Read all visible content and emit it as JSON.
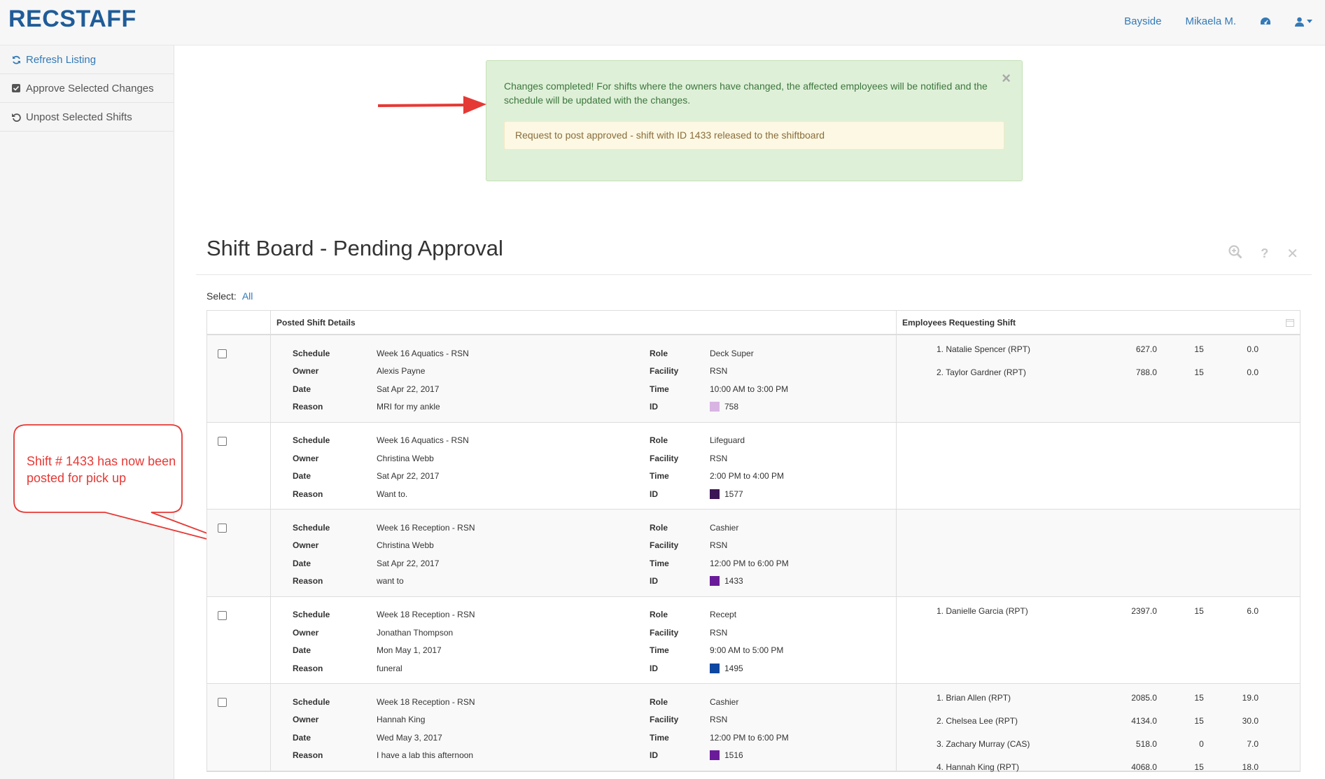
{
  "header": {
    "brand": "RECSTAFF",
    "location": "Bayside",
    "user": "Mikaela M."
  },
  "sidebar": {
    "items": [
      {
        "label": "Refresh Listing",
        "icon": "refresh-icon"
      },
      {
        "label": "Approve Selected Changes",
        "icon": "checkbox-icon"
      },
      {
        "label": "Unpost Selected Shifts",
        "icon": "undo-icon"
      }
    ]
  },
  "alert": {
    "message": "Changes completed! For shifts where the owners have changed, the affected employees will be notified and the schedule will be updated with the changes.",
    "notice": "Request to post approved - shift with ID 1433 released to the shiftboard",
    "close": "×"
  },
  "annotation": {
    "callout": "Shift # 1433 has now been posted for pick up"
  },
  "page": {
    "title": "Shift Board - Pending Approval",
    "select_label": "Select:",
    "select_all": "All"
  },
  "table": {
    "col_details": "Posted Shift Details",
    "col_employees": "Employees Requesting Shift",
    "labels": {
      "schedule": "Schedule",
      "owner": "Owner",
      "date": "Date",
      "reason": "Reason",
      "role": "Role",
      "facility": "Facility",
      "time": "Time",
      "id": "ID"
    },
    "rows": [
      {
        "schedule": "Week 16 Aquatics - RSN",
        "owner": "Alexis Payne",
        "date": "Sat Apr 22, 2017",
        "reason": "MRI for my ankle",
        "role": "Deck Super",
        "facility": "RSN",
        "time": "10:00 AM to 3:00 PM",
        "id": "758",
        "color": "#d8b4e2",
        "employees": [
          {
            "name": "1.  Natalie Spencer (RPT)",
            "a": "627.0",
            "b": "15",
            "c": "0.0"
          },
          {
            "name": "2.  Taylor Gardner (RPT)",
            "a": "788.0",
            "b": "15",
            "c": "0.0"
          }
        ]
      },
      {
        "schedule": "Week 16 Aquatics - RSN",
        "owner": "Christina Webb",
        "date": "Sat Apr 22, 2017",
        "reason": "Want to.",
        "role": "Lifeguard",
        "facility": "RSN",
        "time": "2:00 PM to 4:00 PM",
        "id": "1577",
        "color": "#3b1556",
        "employees": []
      },
      {
        "schedule": "Week 16 Reception - RSN",
        "owner": "Christina Webb",
        "date": "Sat Apr 22, 2017",
        "reason": "want to",
        "role": "Cashier",
        "facility": "RSN",
        "time": "12:00 PM to 6:00 PM",
        "id": "1433",
        "color": "#6a1b9a",
        "employees": []
      },
      {
        "schedule": "Week 18 Reception - RSN",
        "owner": "Jonathan Thompson",
        "date": "Mon May 1, 2017",
        "reason": "funeral",
        "role": "Recept",
        "facility": "RSN",
        "time": "9:00 AM to 5:00 PM",
        "id": "1495",
        "color": "#0d47a1",
        "employees": [
          {
            "name": "1.  Danielle Garcia (RPT)",
            "a": "2397.0",
            "b": "15",
            "c": "6.0"
          }
        ]
      },
      {
        "schedule": "Week 18 Reception - RSN",
        "owner": "Hannah King",
        "date": "Wed May 3, 2017",
        "reason": "I have a lab this afternoon",
        "role": "Cashier",
        "facility": "RSN",
        "time": "12:00 PM to 6:00 PM",
        "id": "1516",
        "color": "#6a1b9a",
        "employees": [
          {
            "name": "1.  Brian Allen (RPT)",
            "a": "2085.0",
            "b": "15",
            "c": "19.0"
          },
          {
            "name": "2.  Chelsea Lee (RPT)",
            "a": "4134.0",
            "b": "15",
            "c": "30.0"
          },
          {
            "name": "3.  Zachary Murray (CAS)",
            "a": "518.0",
            "b": "0",
            "c": "7.0"
          },
          {
            "name": "4.  Hannah King (RPT)",
            "a": "4068.0",
            "b": "15",
            "c": "18.0"
          }
        ]
      }
    ]
  }
}
